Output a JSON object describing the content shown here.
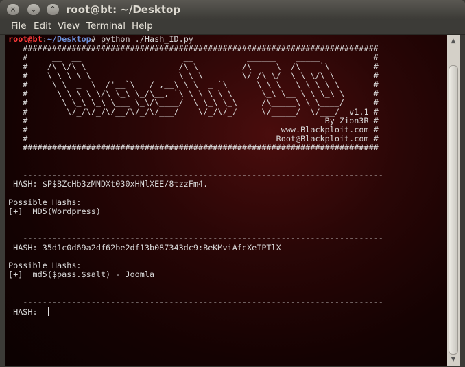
{
  "window": {
    "title": "root@bt: ~/Desktop",
    "buttons": {
      "close": "×",
      "minimize": "⌄",
      "maximize": "^"
    }
  },
  "menu": [
    "File",
    "Edit",
    "View",
    "Terminal",
    "Help"
  ],
  "terminal": {
    "prompt_user": "root@bt",
    "prompt_sep": ":",
    "prompt_path": "~/Desktop",
    "prompt_end": "# ",
    "command": "python ./Hash_ID.py",
    "banner": [
      "   #########################################################################",
      "   #     __  __                     __           ______    _____           #",
      "   #    /\\ \\/\\ \\                   /\\ \\         /\\__  _\\  /\\  _ `\\         #",
      "   #    \\ \\ \\_\\ \\     __      ____ \\ \\ \\___     \\/_/\\ \\/  \\ \\ \\/\\ \\        #",
      "   #     \\ \\  _  \\  /'__`\\   / ,__\\ \\ \\  _ `\\      \\ \\ \\   \\ \\ \\ \\ \\       #",
      "   #      \\ \\ \\ \\ \\/\\ \\_\\ \\_/\\__, `\\ \\ \\ \\ \\ \\      \\_\\ \\__ \\ \\ \\_\\ \\      #",
      "   #       \\ \\_\\ \\_\\ \\___ \\_\\/\\____/  \\ \\_\\ \\_\\     /\\_____\\ \\ \\____/      #",
      "   #        \\/_/\\/_/\\/__/\\/_/\\/___/    \\/_/\\/_/     \\/_____/  \\/___/  v1.1 #",
      "   #                                                             By Zion3R #",
      "   #                                                    www.Blackploit.com #",
      "   #                                                   Root@Blackploit.com #",
      "   #########################################################################"
    ],
    "divider": "   --------------------------------------------------------------------------",
    "entries": [
      {
        "hash_label": " HASH: ",
        "hash_value": "$P$BZcHb3zMNDXt030xHNlXEE/8tzzFm4.",
        "possible": "Possible Hashs:",
        "result": "[+]  MD5(Wordpress)"
      },
      {
        "hash_label": " HASH: ",
        "hash_value": "35d1c0d69a2df62be2df13b087343dc9:BeKMviAfcXeTPTlX",
        "possible": "Possible Hashs:",
        "result": "[+]  md5($pass.$salt) - Joomla"
      }
    ],
    "input_label": " HASH: "
  }
}
